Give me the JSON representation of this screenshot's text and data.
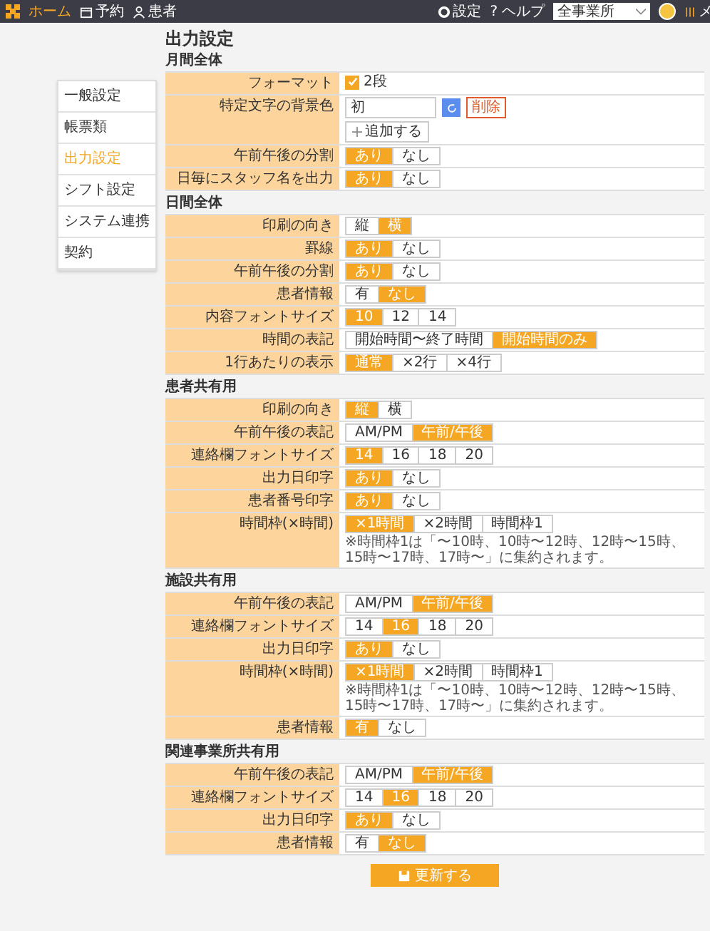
{
  "topbar": {
    "nav": [
      {
        "kind": "home",
        "label": "ホーム",
        "selected": true
      },
      {
        "kind": "calendar",
        "label": "予約",
        "selected": false
      },
      {
        "kind": "person",
        "label": "患者",
        "selected": false
      }
    ],
    "settings": "設定",
    "help_mark": "?",
    "help": "ヘルプ",
    "office": "全事業所",
    "menu": "メ"
  },
  "sidebar": [
    {
      "label": "一般設定",
      "selected": false
    },
    {
      "label": "帳票類",
      "selected": false
    },
    {
      "label": "出力設定",
      "selected": true
    },
    {
      "label": "シフト設定",
      "selected": false
    },
    {
      "label": "システム連携",
      "selected": false
    },
    {
      "label": "契約",
      "selected": false
    }
  ],
  "page_title": "出力設定",
  "sections": [
    {
      "title": "月間全体",
      "rows": [
        {
          "label": "フォーマット",
          "kind": "checkbox",
          "text": "2段",
          "checked": true
        },
        {
          "label": "特定文字の背景色",
          "kind": "colors",
          "value": "初",
          "delete": "削除",
          "add": "追加する"
        },
        {
          "label": "午前午後の分割",
          "kind": "toggle",
          "options": [
            {
              "label": "あり",
              "selected": true
            },
            {
              "label": "なし",
              "selected": false
            }
          ]
        },
        {
          "label": "日毎にスタッフ名を出力",
          "kind": "toggle",
          "options": [
            {
              "label": "あり",
              "selected": true
            },
            {
              "label": "なし",
              "selected": false
            }
          ]
        }
      ]
    },
    {
      "title": "日間全体",
      "rows": [
        {
          "label": "印刷の向き",
          "kind": "toggle",
          "options": [
            {
              "label": "縦",
              "selected": false
            },
            {
              "label": "横",
              "selected": true
            }
          ]
        },
        {
          "label": "罫線",
          "kind": "toggle",
          "options": [
            {
              "label": "あり",
              "selected": true
            },
            {
              "label": "なし",
              "selected": false
            }
          ]
        },
        {
          "label": "午前午後の分割",
          "kind": "toggle",
          "options": [
            {
              "label": "あり",
              "selected": true
            },
            {
              "label": "なし",
              "selected": false
            }
          ]
        },
        {
          "label": "患者情報",
          "kind": "toggle",
          "options": [
            {
              "label": "有",
              "selected": false
            },
            {
              "label": "なし",
              "selected": true
            }
          ]
        },
        {
          "label": "内容フォントサイズ",
          "kind": "toggle",
          "options": [
            {
              "label": "10",
              "selected": true
            },
            {
              "label": "12",
              "selected": false
            },
            {
              "label": "14",
              "selected": false
            }
          ]
        },
        {
          "label": "時間の表記",
          "kind": "toggle",
          "options": [
            {
              "label": "開始時間〜終了時間",
              "selected": false
            },
            {
              "label": "開始時間のみ",
              "selected": true
            }
          ]
        },
        {
          "label": "1行あたりの表示",
          "kind": "toggle",
          "options": [
            {
              "label": "通常",
              "selected": true
            },
            {
              "label": "×2行",
              "selected": false
            },
            {
              "label": "×4行",
              "selected": false
            }
          ]
        }
      ]
    },
    {
      "title": "患者共有用",
      "rows": [
        {
          "label": "印刷の向き",
          "kind": "toggle",
          "options": [
            {
              "label": "縦",
              "selected": true
            },
            {
              "label": "横",
              "selected": false
            }
          ]
        },
        {
          "label": "午前午後の表記",
          "kind": "toggle",
          "options": [
            {
              "label": "AM/PM",
              "selected": false
            },
            {
              "label": "午前/午後",
              "selected": true
            }
          ]
        },
        {
          "label": "連絡欄フォントサイズ",
          "kind": "toggle",
          "options": [
            {
              "label": "14",
              "selected": true
            },
            {
              "label": "16",
              "selected": false
            },
            {
              "label": "18",
              "selected": false
            },
            {
              "label": "20",
              "selected": false
            }
          ]
        },
        {
          "label": "出力日印字",
          "kind": "toggle",
          "options": [
            {
              "label": "あり",
              "selected": true
            },
            {
              "label": "なし",
              "selected": false
            }
          ]
        },
        {
          "label": "患者番号印字",
          "kind": "toggle",
          "options": [
            {
              "label": "あり",
              "selected": true
            },
            {
              "label": "なし",
              "selected": false
            }
          ]
        },
        {
          "label": "時間枠(×時間)",
          "kind": "toggle",
          "options": [
            {
              "label": "×1時間",
              "selected": true
            },
            {
              "label": "×2時間",
              "selected": false
            },
            {
              "label": "時間枠1",
              "selected": false
            }
          ],
          "note": "※時間枠1は「〜10時、10時〜12時、12時〜15時、15時〜17時、17時〜」に集約されます。"
        }
      ]
    },
    {
      "title": "施設共有用",
      "rows": [
        {
          "label": "午前午後の表記",
          "kind": "toggle",
          "options": [
            {
              "label": "AM/PM",
              "selected": false
            },
            {
              "label": "午前/午後",
              "selected": true
            }
          ]
        },
        {
          "label": "連絡欄フォントサイズ",
          "kind": "toggle",
          "options": [
            {
              "label": "14",
              "selected": false
            },
            {
              "label": "16",
              "selected": true
            },
            {
              "label": "18",
              "selected": false
            },
            {
              "label": "20",
              "selected": false
            }
          ]
        },
        {
          "label": "出力日印字",
          "kind": "toggle",
          "options": [
            {
              "label": "あり",
              "selected": true
            },
            {
              "label": "なし",
              "selected": false
            }
          ]
        },
        {
          "label": "時間枠(×時間)",
          "kind": "toggle",
          "options": [
            {
              "label": "×1時間",
              "selected": true
            },
            {
              "label": "×2時間",
              "selected": false
            },
            {
              "label": "時間枠1",
              "selected": false
            }
          ],
          "note": "※時間枠1は「〜10時、10時〜12時、12時〜15時、15時〜17時、17時〜」に集約されます。"
        },
        {
          "label": "患者情報",
          "kind": "toggle",
          "options": [
            {
              "label": "有",
              "selected": true
            },
            {
              "label": "なし",
              "selected": false
            }
          ]
        }
      ]
    },
    {
      "title": "関連事業所共有用",
      "rows": [
        {
          "label": "午前午後の表記",
          "kind": "toggle",
          "options": [
            {
              "label": "AM/PM",
              "selected": false
            },
            {
              "label": "午前/午後",
              "selected": true
            }
          ]
        },
        {
          "label": "連絡欄フォントサイズ",
          "kind": "toggle",
          "options": [
            {
              "label": "14",
              "selected": false
            },
            {
              "label": "16",
              "selected": true
            },
            {
              "label": "18",
              "selected": false
            },
            {
              "label": "20",
              "selected": false
            }
          ]
        },
        {
          "label": "出力日印字",
          "kind": "toggle",
          "options": [
            {
              "label": "あり",
              "selected": true
            },
            {
              "label": "なし",
              "selected": false
            }
          ]
        },
        {
          "label": "患者情報",
          "kind": "toggle",
          "options": [
            {
              "label": "有",
              "selected": false
            },
            {
              "label": "なし",
              "selected": true
            }
          ]
        }
      ]
    }
  ],
  "save_button": "更新する"
}
